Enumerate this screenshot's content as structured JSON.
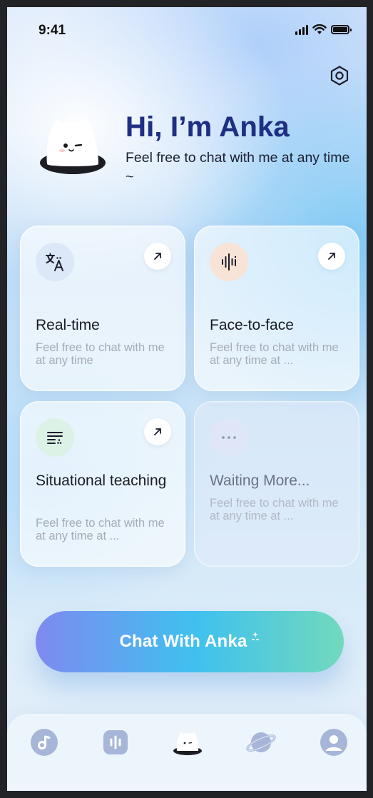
{
  "status_bar": {
    "time": "9:41"
  },
  "hero": {
    "title": "Hi, I’m Anka",
    "subtitle": "Feel free to chat with me at any time ~"
  },
  "cards": [
    {
      "title": "Real-time",
      "description": "Feel free to chat with me at any time",
      "icon": "translate-icon",
      "icon_bg": "#dce7f7"
    },
    {
      "title": "Face-to-face",
      "description": "Feel free to chat with me at any time at ...",
      "icon": "voice-wave-icon",
      "icon_bg": "#f8e4d6"
    },
    {
      "title": "Situational teaching",
      "description": "Feel free to chat with me at any time at ...",
      "icon": "text-lines-icon",
      "icon_bg": "#dcf2e7"
    },
    {
      "title": "Waiting More...",
      "description": "Feel free to chat with me at any time at  ...",
      "icon": "more-dots-icon",
      "icon_bg": "#dfe6f7"
    }
  ],
  "cta": {
    "label": "Chat With Anka"
  },
  "tabbar": {
    "items": [
      "music-icon",
      "audio-bars-icon",
      "anka-mascot-icon",
      "planet-icon",
      "profile-icon"
    ],
    "active": "anka-mascot-icon"
  },
  "colors": {
    "title": "#1f2f83",
    "cta_start": "#7e8af0",
    "cta_mid": "#3fc1ef",
    "cta_end": "#72d9bd",
    "tab_icon": "#9fb0d6"
  }
}
